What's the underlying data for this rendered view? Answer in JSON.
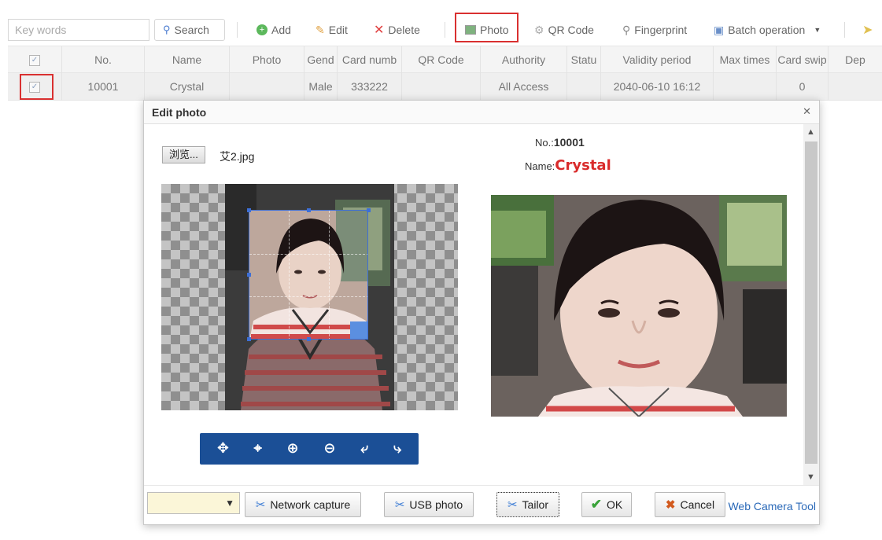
{
  "toolbar": {
    "keywords_placeholder": "Key words",
    "search_label": "Search",
    "add_label": "Add",
    "edit_label": "Edit",
    "delete_label": "Delete",
    "photo_label": "Photo",
    "qrcode_label": "QR Code",
    "fingerprint_label": "Fingerprint",
    "batch_label": "Batch operation"
  },
  "grid": {
    "columns": [
      "No.",
      "Name",
      "Photo",
      "Gend",
      "Card numb",
      "QR Code",
      "Authority",
      "Statu",
      "Validity period",
      "Max times",
      "Card swip",
      "Dep"
    ],
    "row": {
      "no": "10001",
      "name": "Crystal",
      "photo": "",
      "gender": "Male",
      "card": "333222",
      "qr": "",
      "authority": "All Access",
      "status": "",
      "validity": "2040-06-10 16:12",
      "max_times": "",
      "card_swipes": "0",
      "dept": ""
    }
  },
  "dialog": {
    "title": "Edit photo",
    "close_glyph": "✕",
    "browse_label": "浏览...",
    "file_name": "艾2.jpg",
    "no_label": "No.:",
    "no_value": "10001",
    "name_label": "Name:",
    "name_value": "Crystal",
    "footer": {
      "select_value": "",
      "network_capture": "Network capture",
      "usb_photo": "USB photo",
      "tailor": "Tailor",
      "ok": "OK",
      "cancel": "Cancel",
      "web_camera_tool": "Web Camera Tool"
    }
  },
  "colors": {
    "highlight": "#d93030",
    "edit_toolbar": "#1b4f96",
    "name_value": "#d92b2b"
  }
}
